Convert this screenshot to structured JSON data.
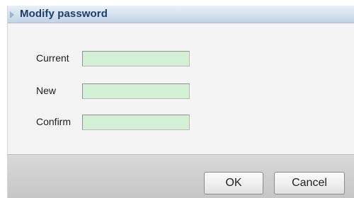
{
  "dialog": {
    "title": "Modify password",
    "fields": {
      "current": {
        "label": "Current",
        "value": ""
      },
      "new": {
        "label": "New",
        "value": ""
      },
      "confirm": {
        "label": "Confirm",
        "value": ""
      }
    },
    "buttons": {
      "ok": "OK",
      "cancel": "Cancel"
    }
  },
  "colors": {
    "title_text": "#1a3f6b",
    "input_background": "#d4f0d4"
  },
  "icons": {
    "title_icon": "triangle-right-icon"
  }
}
